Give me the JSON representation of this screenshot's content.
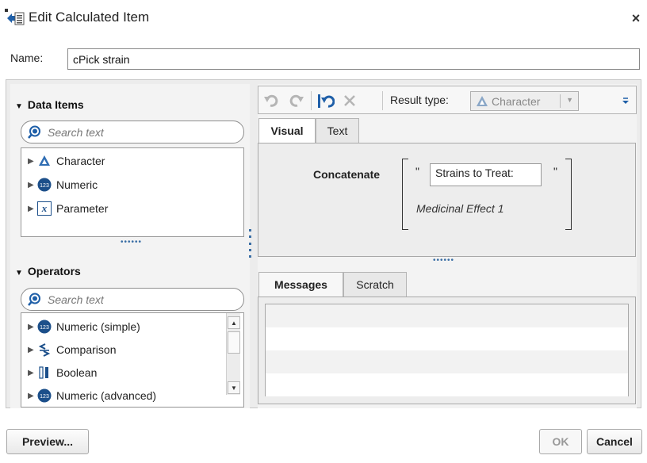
{
  "window": {
    "title": "Edit Calculated Item",
    "close_symbol": "×"
  },
  "name_field": {
    "label": "Name:",
    "value": "cPick strain"
  },
  "data_items": {
    "header": "Data Items",
    "search_placeholder": "Search text",
    "items": [
      {
        "label": "Character",
        "icon": "character-icon"
      },
      {
        "label": "Numeric",
        "icon": "numeric-icon"
      },
      {
        "label": "Parameter",
        "icon": "parameter-icon"
      }
    ],
    "splitter": "••••••"
  },
  "operators": {
    "header": "Operators",
    "search_placeholder": "Search text",
    "items": [
      {
        "label": "Numeric (simple)",
        "icon": "numeric-icon"
      },
      {
        "label": "Comparison",
        "icon": "comparison-icon"
      },
      {
        "label": "Boolean",
        "icon": "boolean-icon"
      },
      {
        "label": "Numeric (advanced)",
        "icon": "numeric-icon"
      }
    ]
  },
  "toolbar": {
    "result_type_label": "Result type:",
    "result_type_value": "Character"
  },
  "editor_tabs": [
    "Visual",
    "Text"
  ],
  "expression": {
    "function": "Concatenate",
    "quote_open": "\"",
    "literal": "Strains to Treat:",
    "quote_close": "\"",
    "second_arg": "Medicinal Effect 1"
  },
  "splitter_middle": "••••••",
  "bottom_tabs": [
    "Messages",
    "Scratch"
  ],
  "buttons": {
    "preview": "Preview...",
    "ok": "OK",
    "cancel": "Cancel"
  },
  "colors": {
    "accent_blue": "#1f5fa8",
    "character_icon": "#2f6db3",
    "numeric_icon": "#1c4f8a"
  }
}
